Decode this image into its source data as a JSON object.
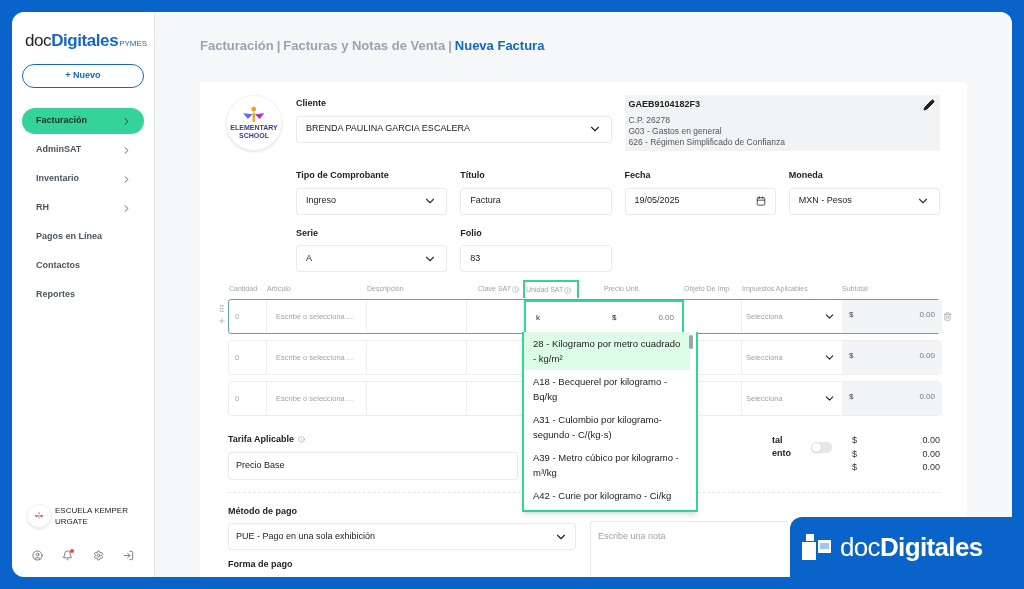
{
  "brand": {
    "prefix": "doc",
    "name": "Digitales",
    "suffix": "PYMES"
  },
  "new_button": "+ Nuevo",
  "nav": [
    {
      "label": "Facturación",
      "selected": true,
      "has_children": true
    },
    {
      "label": "AdminSAT",
      "selected": false,
      "has_children": true
    },
    {
      "label": "Inventario",
      "selected": false,
      "has_children": true
    },
    {
      "label": "RH",
      "selected": false,
      "has_children": true
    },
    {
      "label": "Pagos en Línea",
      "selected": false,
      "has_children": false
    },
    {
      "label": "Contactos",
      "selected": false,
      "has_children": false
    },
    {
      "label": "Reportes",
      "selected": false,
      "has_children": false
    }
  ],
  "account": {
    "name": "ESCUELA KEMPER URGATE",
    "notification": true
  },
  "breadcrumb_separator": "|",
  "breadcrumb": [
    {
      "label": "Facturación",
      "current": false
    },
    {
      "label": "Facturas y Notas de Venta",
      "current": false
    },
    {
      "label": "Nueva Factura",
      "current": true
    }
  ],
  "client": {
    "logo_text": "ELEMENTARY SCHOOL",
    "label": "Cliente",
    "value": "BRENDA PAULINA GARCIA ESCALERA",
    "rfc": "GAEB9104182F3",
    "details": [
      "C.P. 26278",
      "G03 - Gastos en general",
      "626 - Régimen Simplificado de Confianza"
    ]
  },
  "fields": [
    {
      "label": "Tipo de Comprobante",
      "value": "Ingreso",
      "kind": "select"
    },
    {
      "label": "Título",
      "value": "Factura",
      "kind": "text"
    },
    {
      "label": "Fecha",
      "value": "19/05/2025",
      "kind": "date"
    },
    {
      "label": "Moneda",
      "value": "MXN - Pesos",
      "kind": "select"
    },
    {
      "label": "Serie",
      "value": "A",
      "kind": "select"
    },
    {
      "label": "Folio",
      "value": "83",
      "kind": "text"
    }
  ],
  "items": {
    "columns": [
      {
        "label": "Cantidad",
        "info": false,
        "selected": false
      },
      {
        "label": "Artículo",
        "info": false,
        "selected": false
      },
      {
        "label": "Descripción",
        "info": false,
        "selected": false
      },
      {
        "label": "Clave SAT",
        "info": true,
        "selected": false
      },
      {
        "label": "Unidad SAT",
        "info": true,
        "selected": true
      },
      {
        "label": "Precio Unit.",
        "info": false,
        "selected": false
      },
      {
        "label": "Objeto De Imp.",
        "info": false,
        "selected": false
      },
      {
        "label": "Impuestos Aplicables",
        "info": false,
        "selected": false
      },
      {
        "label": "Subtotal",
        "info": false,
        "selected": false
      }
    ],
    "rows": [
      {
        "active": true,
        "quantity": "0",
        "article_placeholder": "Escribe o selecciona ...",
        "unit": "k",
        "price_currency": "$",
        "price": "0.00",
        "taxes_placeholder": "Selecciona",
        "subtotal_currency": "$",
        "subtotal": "0.00"
      },
      {
        "active": false,
        "quantity": "0",
        "article_placeholder": "Escribe o selecciona ...",
        "taxes_placeholder": "Selecciona",
        "subtotal_currency": "$",
        "subtotal": "0.00"
      },
      {
        "active": false,
        "quantity": "0",
        "article_placeholder": "Escribe o selecciona ...",
        "taxes_placeholder": "Selecciona",
        "subtotal_currency": "$",
        "subtotal": "0.00"
      }
    ]
  },
  "unit_dropdown": [
    {
      "label": "28 - Kilogramo por metro cuadrado - kg/m²",
      "selected": true
    },
    {
      "label": "A18 - Becquerel por kilogramo - Bq/kg",
      "selected": false
    },
    {
      "label": "A31 - Culombio por kilogramo-segundo - C/(kg·s)",
      "selected": false
    },
    {
      "label": "A39 - Metro cúbico por kilogramo - m³/kg",
      "selected": false
    },
    {
      "label": "A42 - Curie por kilogramo - Ci/kg",
      "selected": false
    }
  ],
  "tarifa": {
    "label": "Tarifa Aplicable",
    "value": "Precio Base"
  },
  "totals": {
    "labels": [
      "tal",
      "ento"
    ],
    "toggle_on": false,
    "lines": [
      {
        "currency": "$",
        "value": "0.00"
      },
      {
        "currency": "$",
        "value": "0.00"
      },
      {
        "currency": "$",
        "value": "0.00"
      }
    ]
  },
  "payment_method": {
    "label": "Método de pago",
    "value": "PUE - Pago en una sola exhibición"
  },
  "note": {
    "placeholder": "Escribe una nota"
  },
  "payment_form": {
    "label": "Forma de pago"
  },
  "badge": {
    "prefix": "doc",
    "name": "Digitales"
  }
}
